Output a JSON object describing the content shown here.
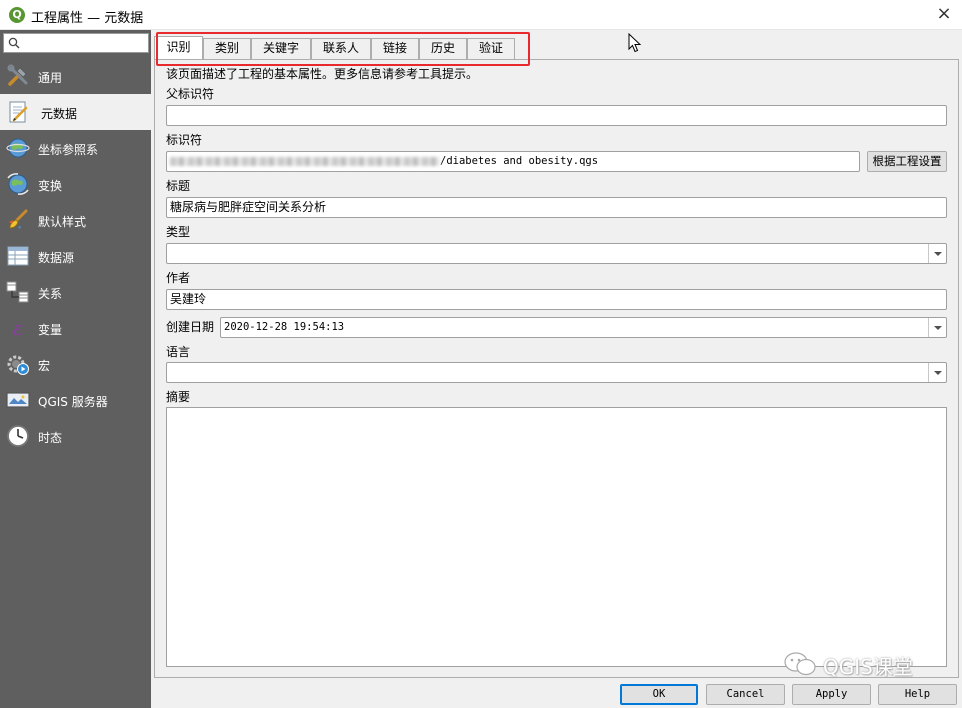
{
  "window": {
    "title": "工程属性 — 元数据",
    "close": "×"
  },
  "sidebar": {
    "search_value": "",
    "items": [
      {
        "label": "通用",
        "icon": "tools-icon"
      },
      {
        "label": "元数据",
        "icon": "metadata-icon",
        "active": true
      },
      {
        "label": "坐标参照系",
        "icon": "crs-globe-icon"
      },
      {
        "label": "变换",
        "icon": "transform-globe-icon"
      },
      {
        "label": "默认样式",
        "icon": "paint-brush-icon"
      },
      {
        "label": "数据源",
        "icon": "data-sources-icon"
      },
      {
        "label": "关系",
        "icon": "relations-icon"
      },
      {
        "label": "变量",
        "icon": "variables-icon"
      },
      {
        "label": "宏",
        "icon": "macro-gear-icon"
      },
      {
        "label": "QGIS 服务器",
        "icon": "server-icon"
      },
      {
        "label": "时态",
        "icon": "clock-icon"
      }
    ]
  },
  "tabs": [
    {
      "label": "识别",
      "active": true
    },
    {
      "label": "类别"
    },
    {
      "label": "关键字"
    },
    {
      "label": "联系人"
    },
    {
      "label": "链接"
    },
    {
      "label": "历史"
    },
    {
      "label": "验证"
    }
  ],
  "form": {
    "description": "该页面描述了工程的基本属性。更多信息请参考工具提示。",
    "parent_id_label": "父标识符",
    "parent_id_value": "",
    "identifier_label": "标识符",
    "identifier_value": "/diabetes and obesity.qgs",
    "set_from_project_button": "根据工程设置",
    "title_label": "标题",
    "title_value": "糖尿病与肥胖症空间关系分析",
    "type_label": "类型",
    "type_value": "",
    "author_label": "作者",
    "author_value": "吴建玲",
    "creation_date_label": "创建日期",
    "creation_date_value": "2020-12-28 19:54:13",
    "language_label": "语言",
    "language_value": "",
    "abstract_label": "摘要",
    "abstract_value": ""
  },
  "buttons": {
    "ok": "OK",
    "cancel": "Cancel",
    "apply": "Apply",
    "help": "Help"
  },
  "watermark": "QGIS课堂",
  "colors": {
    "sidebar_bg": "#5f5f5f",
    "highlight_box": "#e8292e",
    "default_button_border": "#0078d7",
    "qgis_green": "#589632"
  }
}
